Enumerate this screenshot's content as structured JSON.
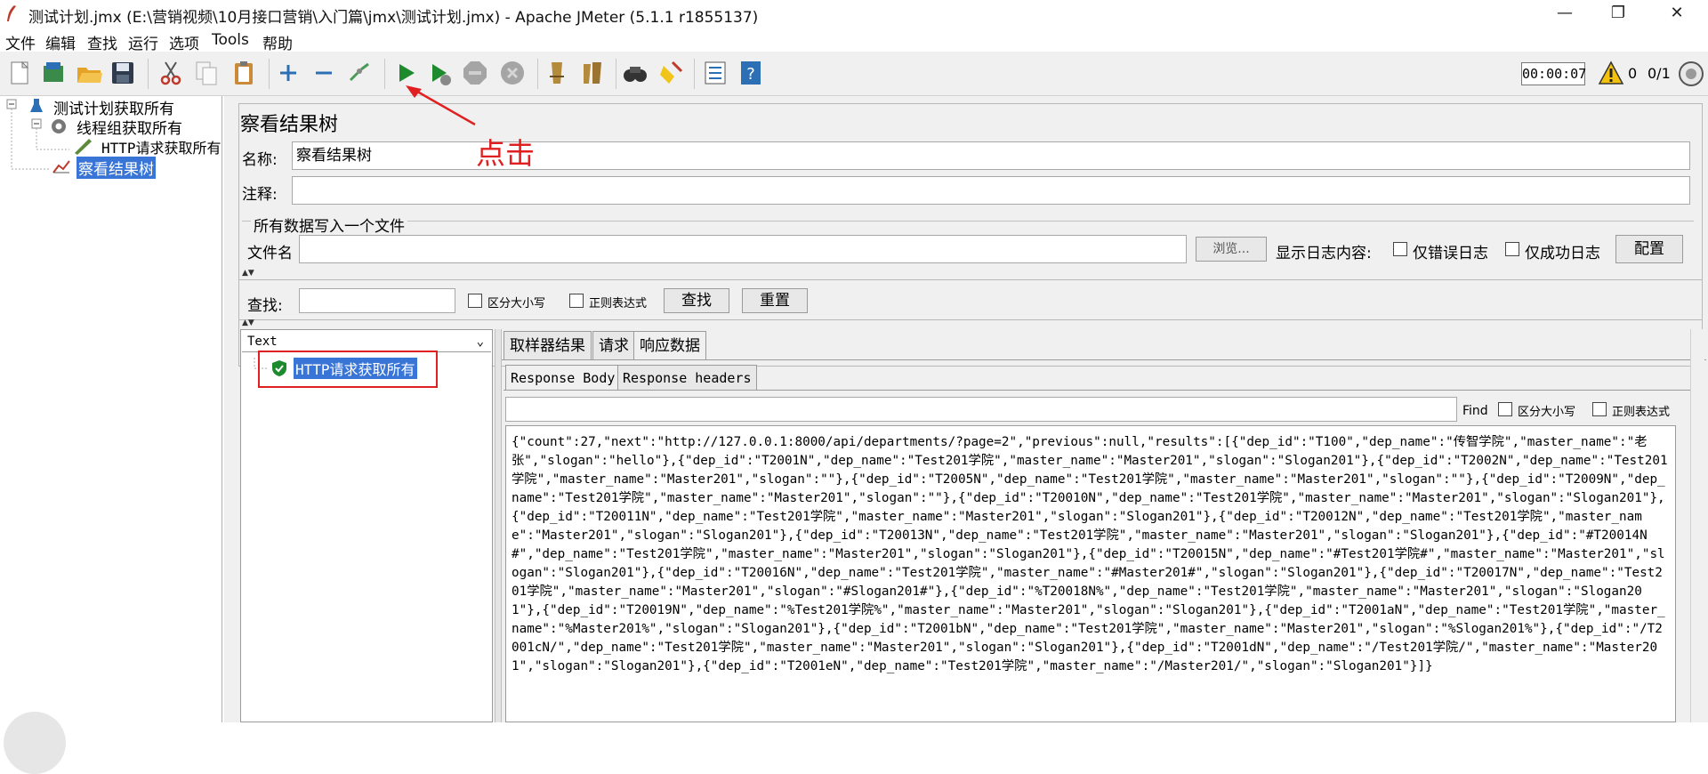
{
  "window": {
    "title": "测试计划.jmx (E:\\营销视频\\10月接口营销\\入门篇\\jmx\\测试计划.jmx) - Apache JMeter (5.1.1 r1855137)",
    "minimize": "—",
    "maximize": "❐",
    "close": "✕"
  },
  "menu": [
    "文件",
    "编辑",
    "查找",
    "运行",
    "选项",
    "Tools",
    "帮助"
  ],
  "toolbar": {
    "icons": [
      "new-icon",
      "templates-icon",
      "open-icon",
      "save-icon",
      "cut-icon",
      "copy-icon",
      "paste-icon",
      "expand-icon",
      "collapse-icon",
      "toggle-icon",
      "start-icon",
      "start-no-pause-icon",
      "stop-icon",
      "shutdown-icon",
      "clear-icon",
      "clear-all-icon",
      "search-icon",
      "reset-search-icon",
      "function-helper-icon",
      "help-icon"
    ],
    "timer": "00:00:07",
    "warning_count": "0",
    "threads": "0/1"
  },
  "tree": {
    "test_plan": "测试计划获取所有",
    "thread_group": "线程组获取所有",
    "http_request": "HTTP请求获取所有",
    "listener": "察看结果树"
  },
  "panel": {
    "title": "察看结果树",
    "name_label": "名称:",
    "name_value": "察看结果树",
    "comment_label": "注释:",
    "file_section": "所有数据写入一个文件",
    "file_label": "文件名",
    "browse_button": "浏览...",
    "log_display_label": "显示日志内容:",
    "errors_only": "仅错误日志",
    "success_only": "仅成功日志",
    "configure_button": "配置",
    "search_label": "查找:",
    "case_sensitive": "区分大小写",
    "regex": "正则表达式",
    "find_button": "查找",
    "reset_button": "重置"
  },
  "results": {
    "renderer": "Text",
    "sample_item": "HTTP请求获取所有",
    "tabs": [
      "取样器结果",
      "请求",
      "响应数据"
    ],
    "active_tab": "响应数据",
    "subtabs": [
      "Response Body",
      "Response headers"
    ],
    "find_label": "Find",
    "find_case": "区分大小写",
    "find_regex": "正则表达式",
    "response_body": "{\"count\":27,\"next\":\"http://127.0.0.1:8000/api/departments/?page=2\",\"previous\":null,\"results\":[{\"dep_id\":\"T100\",\"dep_name\":\"传智学院\",\"master_name\":\"老张\",\"slogan\":\"hello\"},{\"dep_id\":\"T2001N\",\"dep_name\":\"Test201学院\",\"master_name\":\"Master201\",\"slogan\":\"Slogan201\"},{\"dep_id\":\"T2002N\",\"dep_name\":\"Test201学院\",\"master_name\":\"Master201\",\"slogan\":\"\"},{\"dep_id\":\"T2005N\",\"dep_name\":\"Test201学院\",\"master_name\":\"Master201\",\"slogan\":\"\"},{\"dep_id\":\"T2009N\",\"dep_name\":\"Test201学院\",\"master_name\":\"Master201\",\"slogan\":\"\"},{\"dep_id\":\"T20010N\",\"dep_name\":\"Test201学院\",\"master_name\":\"Master201\",\"slogan\":\"Slogan201\"},{\"dep_id\":\"T20011N\",\"dep_name\":\"Test201学院\",\"master_name\":\"Master201\",\"slogan\":\"Slogan201\"},{\"dep_id\":\"T20012N\",\"dep_name\":\"Test201学院\",\"master_name\":\"Master201\",\"slogan\":\"Slogan201\"},{\"dep_id\":\"T20013N\",\"dep_name\":\"Test201学院\",\"master_name\":\"Master201\",\"slogan\":\"Slogan201\"},{\"dep_id\":\"#T20014N#\",\"dep_name\":\"Test201学院\",\"master_name\":\"Master201\",\"slogan\":\"Slogan201\"},{\"dep_id\":\"T20015N\",\"dep_name\":\"#Test201学院#\",\"master_name\":\"Master201\",\"slogan\":\"Slogan201\"},{\"dep_id\":\"T20016N\",\"dep_name\":\"Test201学院\",\"master_name\":\"#Master201#\",\"slogan\":\"Slogan201\"},{\"dep_id\":\"T20017N\",\"dep_name\":\"Test201学院\",\"master_name\":\"Master201\",\"slogan\":\"#Slogan201#\"},{\"dep_id\":\"%T20018N%\",\"dep_name\":\"Test201学院\",\"master_name\":\"Master201\",\"slogan\":\"Slogan201\"},{\"dep_id\":\"T20019N\",\"dep_name\":\"%Test201学院%\",\"master_name\":\"Master201\",\"slogan\":\"Slogan201\"},{\"dep_id\":\"T2001aN\",\"dep_name\":\"Test201学院\",\"master_name\":\"%Master201%\",\"slogan\":\"Slogan201\"},{\"dep_id\":\"T2001bN\",\"dep_name\":\"Test201学院\",\"master_name\":\"Master201\",\"slogan\":\"%Slogan201%\"},{\"dep_id\":\"/T2001cN/\",\"dep_name\":\"Test201学院\",\"master_name\":\"Master201\",\"slogan\":\"Slogan201\"},{\"dep_id\":\"T2001dN\",\"dep_name\":\"/Test201学院/\",\"master_name\":\"Master201\",\"slogan\":\"Slogan201\"},{\"dep_id\":\"T2001eN\",\"dep_name\":\"Test201学院\",\"master_name\":\"/Master201/\",\"slogan\":\"Slogan201\"}]}"
  },
  "annotation": {
    "click_label": "点击",
    "color": "#e02020"
  }
}
